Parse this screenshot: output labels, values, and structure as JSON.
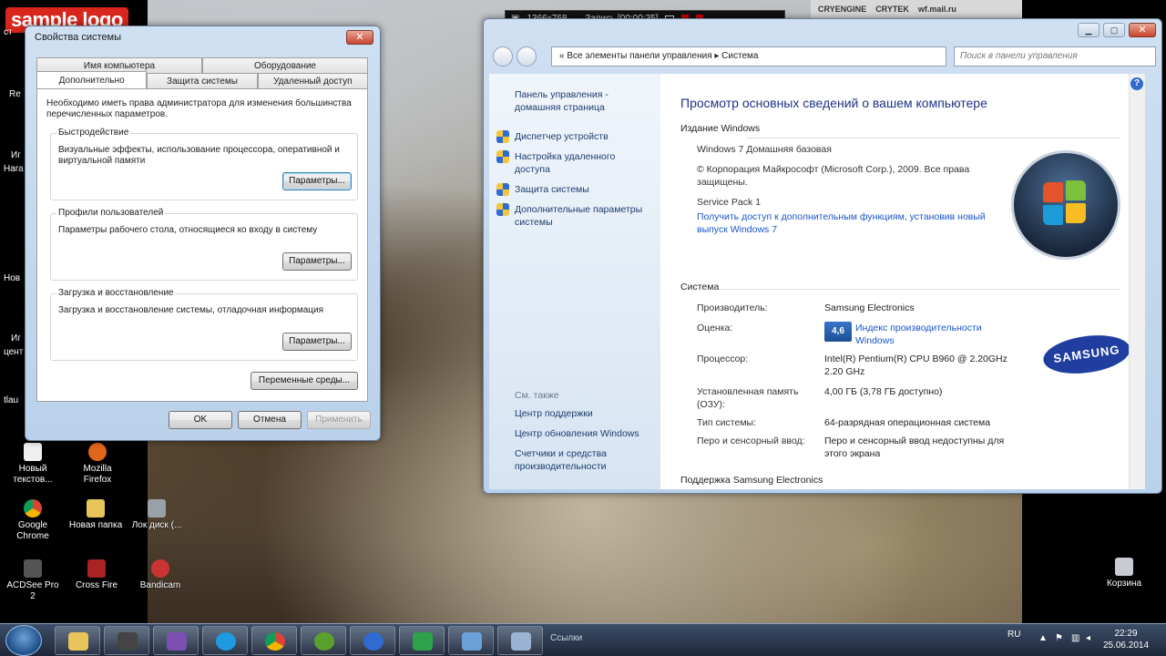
{
  "overlay": {
    "logo": "sample logo",
    "recorder": {
      "resolution": "1366x768",
      "record_label": "Запись [00:00:35]"
    },
    "game_banner": {
      "brand1": "CRYENGINE",
      "brand2": "CRYTEK",
      "site": "wf.mail.ru"
    }
  },
  "desktop": {
    "edge_texts": [
      "ст",
      "Re",
      "Иг",
      "Hara",
      "Нов",
      "Иг",
      "цент",
      "tlau"
    ],
    "icons": [
      {
        "label": "Новый текстов...",
        "color": "#f0f0f0"
      },
      {
        "label": "Mozilla Firefox",
        "color": "#e0661a"
      },
      {
        "label": "Google Chrome",
        "color": "#3aa757"
      },
      {
        "label": "Новая папка",
        "color": "#e8c55a"
      },
      {
        "label": "Лок диск (...",
        "color": "#9aa0a8"
      },
      {
        "label": "ACDSee Pro 2",
        "color": "#555"
      },
      {
        "label": "Cross Fire",
        "color": "#aa2222"
      },
      {
        "label": "Bandicam",
        "color": "#cc3333"
      },
      {
        "label": "Корзина",
        "color": "#c8ccd2"
      }
    ]
  },
  "sysprops": {
    "title": "Свойства системы",
    "tabs_top": [
      "Имя компьютера",
      "Оборудование"
    ],
    "tabs_bottom": [
      "Дополнительно",
      "Защита системы",
      "Удаленный доступ"
    ],
    "intro": "Необходимо иметь права администратора для изменения большинства перечисленных параметров.",
    "groups": [
      {
        "label": "Быстродействие",
        "text": "Визуальные эффекты, использование процессора, оперативной и виртуальной памяти",
        "button": "Параметры..."
      },
      {
        "label": "Профили пользователей",
        "text": "Параметры рабочего стола, относящиеся ко входу в систему",
        "button": "Параметры..."
      },
      {
        "label": "Загрузка и восстановление",
        "text": "Загрузка и восстановление системы, отладочная информация",
        "button": "Параметры..."
      }
    ],
    "env_button": "Переменные среды...",
    "ok": "OK",
    "cancel": "Отмена",
    "apply": "Применить",
    "close_glyph": "✕"
  },
  "cpanel": {
    "breadcrumb": "«  Все элементы панели управления  ▸  Система",
    "search_placeholder": "Поиск в панели управления",
    "left": {
      "home": "Панель управления - домашняя страница",
      "links": [
        "Диспетчер устройств",
        "Настройка удаленного доступа",
        "Защита системы",
        "Дополнительные параметры системы"
      ],
      "see_also": "См. также",
      "also": [
        "Центр поддержки",
        "Центр обновления Windows",
        "Счетчики и средства производительности"
      ]
    },
    "heading": "Просмотр основных сведений о вашем компьютере",
    "edition_title": "Издание Windows",
    "edition": "Windows 7 Домашняя базовая",
    "copyright": "© Корпорация Майкрософт (Microsoft Corp.), 2009. Все права защищены.",
    "sp": "Service Pack 1",
    "upgrade_link": "Получить доступ к дополнительным функциям, установив новый выпуск Windows 7",
    "system_title": "Система",
    "rows": [
      {
        "label": "Производитель:",
        "value": "Samsung Electronics"
      },
      {
        "label": "Оценка:",
        "value": "Индекс производительности Windows"
      },
      {
        "label": "Процессор:",
        "value": "Intel(R) Pentium(R) CPU B960 @ 2.20GHz 2.20 GHz"
      },
      {
        "label": "Установленная память (ОЗУ):",
        "value": "4,00 ГБ (3,78 ГБ доступно)"
      },
      {
        "label": "Тип системы:",
        "value": "64-разрядная операционная система"
      },
      {
        "label": "Перо и сенсорный ввод:",
        "value": "Перо и сенсорный ввод недоступны для этого экрана"
      }
    ],
    "score": "4,6",
    "support_title": "Поддержка Samsung Electronics",
    "brand": "SAMSUNG"
  },
  "taskbar": {
    "apps": [
      {
        "name": "explorer",
        "color": "#e8c55a"
      },
      {
        "name": "terminal",
        "color": "#444"
      },
      {
        "name": "visual-studio",
        "color": "#7a4fb0"
      },
      {
        "name": "skype",
        "color": "#1e9be0"
      },
      {
        "name": "chrome",
        "color": "#3aa757"
      },
      {
        "name": "utorrent",
        "color": "#5aa02c"
      },
      {
        "name": "ie",
        "color": "#2f6bd0"
      },
      {
        "name": "acrobat",
        "color": "#2da24a"
      },
      {
        "name": "control-panel",
        "color": "#6aa2d8"
      },
      {
        "name": "system-props",
        "color": "#9bb4d4"
      }
    ],
    "links_label": "Ссылки",
    "lang": "RU",
    "time": "22:29",
    "date": "25.06.2014"
  }
}
